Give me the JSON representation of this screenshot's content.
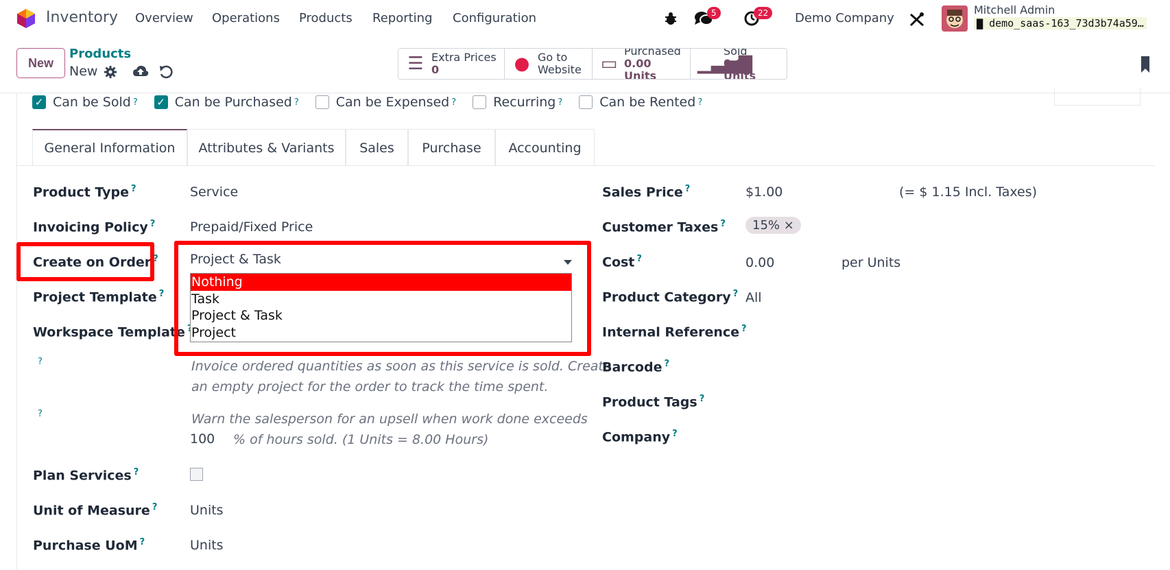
{
  "navbar": {
    "app_name": "Inventory",
    "menu": [
      "Overview",
      "Operations",
      "Products",
      "Reporting",
      "Configuration"
    ],
    "chat_badge": "5",
    "activity_badge": "22",
    "company": "Demo Company",
    "user_name": "Mitchell Admin",
    "db_name": "demo_saas-163_73d3b74a59…"
  },
  "control": {
    "new_label": "New",
    "breadcrumb": "Products",
    "record_name": "New",
    "smart_buttons": [
      {
        "label": "Extra Prices",
        "value": "0"
      },
      {
        "label": "Go to",
        "value": "Website"
      },
      {
        "label": "Purchased",
        "value": "0.00 Units"
      },
      {
        "label": "Sold",
        "value": "0.00 Units"
      }
    ]
  },
  "checks": {
    "can_be_sold": "Can be Sold",
    "can_be_purchased": "Can be Purchased",
    "can_be_expensed": "Can be Expensed",
    "recurring": "Recurring",
    "can_be_rented": "Can be Rented"
  },
  "tabs": [
    "General Information",
    "Attributes & Variants",
    "Sales",
    "Purchase",
    "Accounting"
  ],
  "left": {
    "product_type_label": "Product Type",
    "product_type_value": "Service",
    "invoicing_policy_label": "Invoicing Policy",
    "invoicing_policy_value": "Prepaid/Fixed Price",
    "create_on_order_label": "Create on Order",
    "create_on_order_value": "Project & Task",
    "project_template_label": "Project Template",
    "workspace_template_label": "Workspace Template",
    "help1_line1": "Invoice ordered quantities as soon as this service is sold. Create",
    "help1_line2": "an empty project for the order to track the time spent.",
    "help2_line1": "Warn the salesperson for an upsell when work done exceeds",
    "upsell_value": "100",
    "help2_line2": "% of hours sold. (1 Units = 8.00 Hours)",
    "plan_services_label": "Plan Services",
    "uom_label": "Unit of Measure",
    "uom_value": "Units",
    "purchase_uom_label": "Purchase UoM",
    "purchase_uom_value": "Units"
  },
  "dropdown": {
    "options": [
      "Nothing",
      "Task",
      "Project & Task",
      "Project"
    ],
    "highlighted": "Nothing"
  },
  "right": {
    "sales_price_label": "Sales Price",
    "sales_price_value": "$1.00",
    "sales_price_incl": "(= $ 1.15 Incl. Taxes)",
    "customer_taxes_label": "Customer Taxes",
    "customer_taxes_tag": "15% ×",
    "cost_label": "Cost",
    "cost_value": "0.00",
    "cost_unit": "per Units",
    "product_category_label": "Product Category",
    "product_category_value": "All",
    "internal_ref_label": "Internal Reference",
    "barcode_label": "Barcode",
    "product_tags_label": "Product Tags",
    "company_label": "Company"
  },
  "help_mark": "?"
}
